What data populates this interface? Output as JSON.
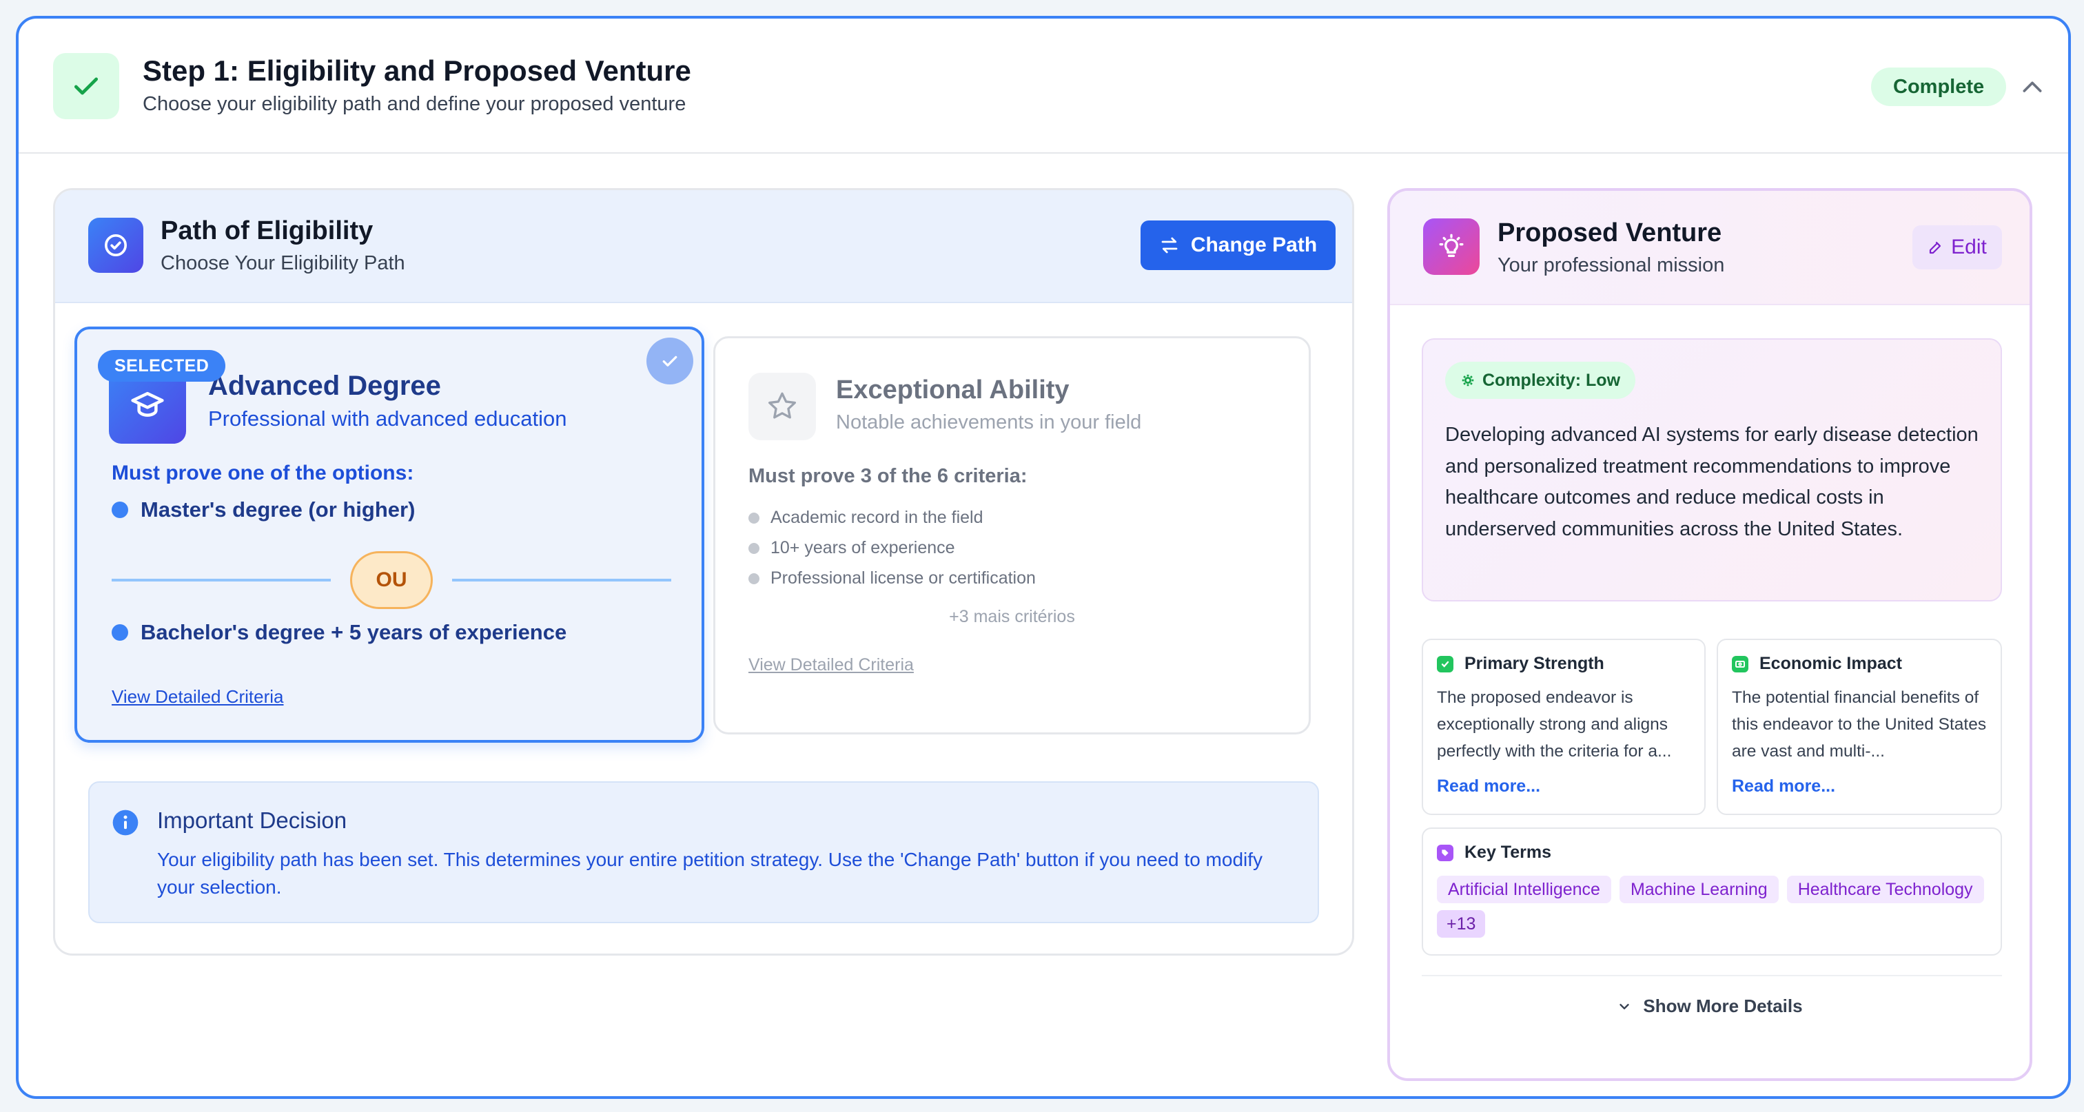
{
  "step": {
    "title": "Step 1: Eligibility and Proposed Venture",
    "subtitle": "Choose your eligibility path and define your proposed venture",
    "status": "Complete"
  },
  "path": {
    "title": "Path of Eligibility",
    "subtitle": "Choose Your Eligibility Path",
    "change_button": "Change Path",
    "advanced": {
      "tag": "SELECTED",
      "title": "Advanced Degree",
      "subtitle": "Professional with advanced education",
      "must_prove": "Must prove one of the options:",
      "option1": "Master's degree (or higher)",
      "or": "OU",
      "option2": "Bachelor's degree + 5 years of experience",
      "link": "View Detailed Criteria"
    },
    "exceptional": {
      "title": "Exceptional Ability",
      "subtitle": "Notable achievements in your field",
      "must_prove": "Must prove 3 of the 6 criteria:",
      "criteria": [
        "Academic record in the field",
        "10+ years of experience",
        "Professional license or certification"
      ],
      "more": "+3 mais critérios",
      "link": "View Detailed Criteria"
    },
    "decision": {
      "title": "Important Decision",
      "text": "Your eligibility path has been set. This determines your entire petition strategy. Use the 'Change Path' button if you need to modify your selection."
    }
  },
  "venture": {
    "title": "Proposed Venture",
    "subtitle": "Your professional mission",
    "edit": "Edit",
    "complexity": "Complexity: Low",
    "description": "Developing advanced AI systems for early disease detection and personalized treatment recommendations to improve healthcare outcomes and reduce medical costs in underserved communities across the United States.",
    "strength": {
      "title": "Primary Strength",
      "text": "The proposed endeavor is exceptionally strong and aligns perfectly with the criteria for a...",
      "read_more": "Read more..."
    },
    "impact": {
      "title": "Economic Impact",
      "text": "The potential financial benefits of this endeavor to the United States are vast and multi-...",
      "read_more": "Read more..."
    },
    "terms": {
      "title": "Key Terms",
      "tags": [
        "Artificial Intelligence",
        "Machine Learning",
        "Healthcare Technology"
      ],
      "more": "+13"
    },
    "show_more": "Show More Details"
  },
  "colors": {
    "accent": "#2563eb",
    "success": "#166534",
    "venture_accent": "#7e22ce"
  }
}
